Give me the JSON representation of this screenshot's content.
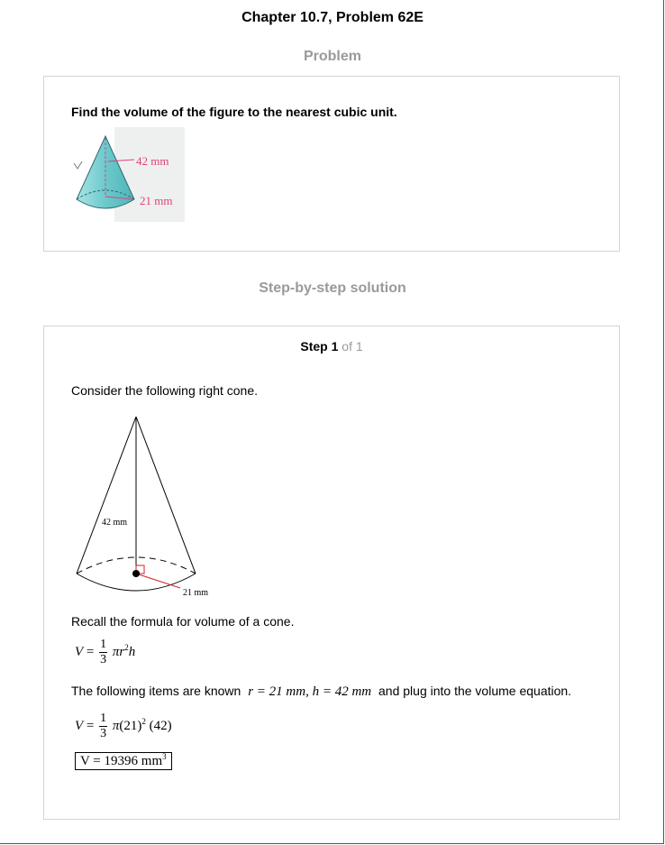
{
  "header": {
    "title": "Chapter 10.7, Problem 62E"
  },
  "problem": {
    "heading": "Problem",
    "text": "Find the volume of the figure to the nearest cubic unit.",
    "figure": {
      "height_label": "42 mm",
      "radius_label": "21 mm"
    }
  },
  "solution": {
    "heading": "Step-by-step solution",
    "step_word": "Step",
    "step_current": "1",
    "step_of": "of 1",
    "intro": "Consider the following right cone.",
    "figure": {
      "height_label": "42 mm",
      "radius_label": "21 mm"
    },
    "recall": "Recall the formula for volume of a cone.",
    "known_prefix": "The following items are known",
    "known_values": "r = 21 mm, h = 42 mm",
    "known_suffix": "and plug into the volume equation.",
    "answer": "V = 19396 mm",
    "answer_exp": "3"
  },
  "colors": {
    "accent_pink": "#e0407a",
    "cone_teal": "#7fd1d3",
    "heading_gray": "#9a9a9a"
  }
}
